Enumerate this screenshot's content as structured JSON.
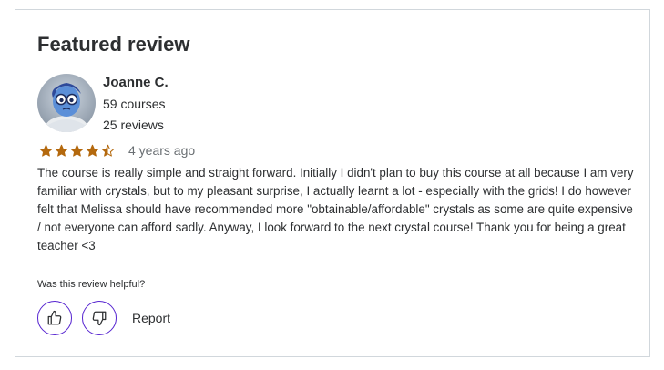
{
  "review": {
    "section_title": "Featured review",
    "reviewer": {
      "name": "Joanne C.",
      "courses": "59 courses",
      "reviews": "25 reviews",
      "avatar_icon": "avatar-cartoon-character"
    },
    "rating": 4.5,
    "rating_max": 5,
    "age": "4 years ago",
    "text": "The course is really simple and straight forward. Initially I didn't plan to buy this course at all because I am very familiar with crystals, but to my pleasant surprise, I actually learnt a lot - especially with the grids! I do however felt that Melissa should have recommended more \"obtainable/affordable\" crystals as some are quite expensive / not everyone can afford sadly. Anyway, I look forward to the next crystal course! Thank you for being a great teacher <3",
    "helpful_question": "Was this review helpful?",
    "report_label": "Report"
  },
  "colors": {
    "star": "#b4690e",
    "accent": "#5624d0",
    "border": "#d1d7dc",
    "text": "#2d2f31",
    "muted": "#6a6f73"
  }
}
